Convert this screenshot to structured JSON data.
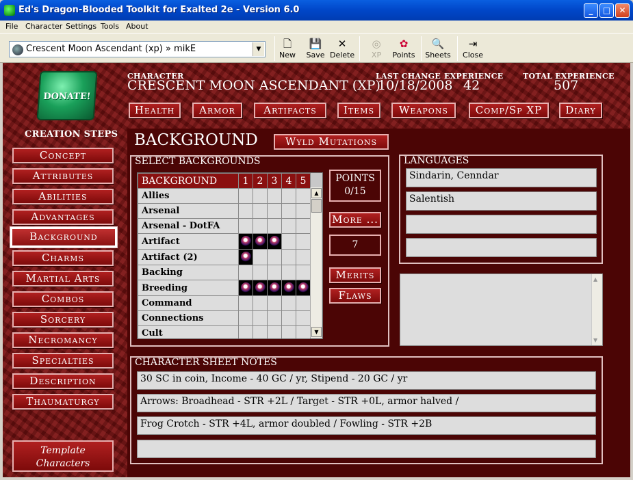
{
  "window": {
    "title": "Ed's Dragon-Blooded Toolkit for Exalted 2e - Version 6.0",
    "min": "_",
    "max": "□",
    "close": "✕"
  },
  "menu": [
    "File",
    "Character",
    "Settings",
    "Tools",
    "About"
  ],
  "toolbar": {
    "selected_character": "Crescent Moon Ascendant (xp) » mikE",
    "buttons": [
      {
        "label": "New",
        "icon": "new-document-icon"
      },
      {
        "label": "Save",
        "icon": "floppy-disk-icon"
      },
      {
        "label": "Delete",
        "icon": "x-mark-icon"
      },
      {
        "label": "XP",
        "icon": "xp-icon",
        "disabled": true
      },
      {
        "label": "Points",
        "icon": "points-icon"
      },
      {
        "label": "Sheets",
        "icon": "sheets-icon"
      },
      {
        "label": "Close",
        "icon": "exit-door-icon"
      }
    ]
  },
  "header": {
    "character_label": "CHARACTER",
    "character_name": "CRESCENT MOON ASCENDANT (XP)",
    "last_change_label": "LAST CHANGE",
    "last_change": "10/18/2008",
    "experience_label": "EXPERIENCE",
    "experience": "42",
    "total_experience_label": "TOTAL EXPERIENCE",
    "total_experience": "507"
  },
  "donate": "DONATE!",
  "top_nav": [
    "Health",
    "Armor",
    "Artifacts",
    "Items",
    "Weapons",
    "Comp/Sp XP",
    "Diary"
  ],
  "creation_steps_label": "CREATION STEPS",
  "creation_steps": [
    "Concept",
    "Attributes",
    "Abilities",
    "Advantages",
    "Background",
    "Charms",
    "Martial Arts",
    "Combos",
    "Sorcery",
    "Necromancy",
    "Specialties",
    "Description",
    "Thaumaturgy"
  ],
  "active_step": "Background",
  "template_characters": [
    "Template",
    "Characters"
  ],
  "page": {
    "title": "BACKGROUND",
    "wyld_button": "Wyld Mutations"
  },
  "backgrounds": {
    "panel_title": "SELECT BACKGROUNDS",
    "header": [
      "BACKGROUND",
      "1",
      "2",
      "3",
      "4",
      "5"
    ],
    "rows": [
      {
        "name": "Allies",
        "dots": 0
      },
      {
        "name": "Arsenal",
        "dots": 0
      },
      {
        "name": "Arsenal - DotFA",
        "dots": 0
      },
      {
        "name": "Artifact",
        "dots": 3
      },
      {
        "name": "Artifact (2)",
        "dots": 1
      },
      {
        "name": "Backing",
        "dots": 0
      },
      {
        "name": "Breeding",
        "dots": 5
      },
      {
        "name": "Command",
        "dots": 0
      },
      {
        "name": "Connections",
        "dots": 0
      },
      {
        "name": "Cult",
        "dots": 0
      }
    ],
    "points_label": "POINTS",
    "points_value": "0/15",
    "more_button": "More ...",
    "count": "7",
    "merits_button": "Merits",
    "flaws_button": "Flaws"
  },
  "languages": {
    "title": "LANGUAGES",
    "entries": [
      "Sindarin, Cenndar",
      "Salentish",
      "",
      ""
    ]
  },
  "notes": {
    "title": "CHARACTER SHEET NOTES",
    "lines": [
      "30 SC in coin, Income - 40 GC / yr, Stipend - 20 GC / yr",
      "Arrows:  Broadhead - STR +2L / Target - STR +0L, armor halved /",
      "Frog Crotch - STR +4L, armor doubled / Fowling - STR +2B",
      ""
    ]
  },
  "colors": {
    "accent_red": "#8a1010",
    "panel_bg": "#4b0505",
    "field_bg": "#dddddd"
  }
}
